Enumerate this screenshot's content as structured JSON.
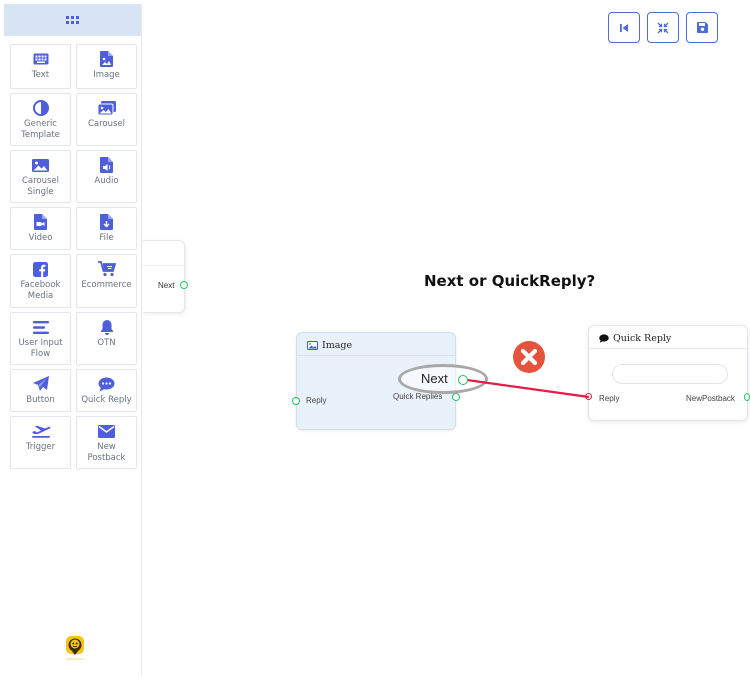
{
  "sidebar": {
    "header_icon": "grid-icon",
    "items": [
      {
        "label": "Text",
        "icon": "keyboard-icon"
      },
      {
        "label": "Image",
        "icon": "image-file-icon"
      },
      {
        "label": "Generic Template",
        "icon": "half-circle-icon"
      },
      {
        "label": "Carousel",
        "icon": "images-icon"
      },
      {
        "label": "Carousel Single",
        "icon": "picture-icon"
      },
      {
        "label": "Audio",
        "icon": "audio-file-icon"
      },
      {
        "label": "Video",
        "icon": "video-file-icon"
      },
      {
        "label": "File",
        "icon": "download-file-icon"
      },
      {
        "label": "Facebook Media",
        "icon": "facebook-icon"
      },
      {
        "label": "Ecommerce",
        "icon": "cart-icon"
      },
      {
        "label": "User Input Flow",
        "icon": "lines-icon"
      },
      {
        "label": "OTN",
        "icon": "bell-icon"
      },
      {
        "label": "Button",
        "icon": "send-icon"
      },
      {
        "label": "Quick Reply",
        "icon": "chat-bubble-icon"
      },
      {
        "label": "Trigger",
        "icon": "plane-icon"
      },
      {
        "label": "New Postback",
        "icon": "envelope-icon"
      }
    ],
    "bottom_icon": "bot-logo-icon"
  },
  "toolbar": {
    "buttons": [
      {
        "name": "skip-back-button",
        "icon": "skip-back-icon"
      },
      {
        "name": "fit-view-button",
        "icon": "compress-icon"
      },
      {
        "name": "save-button",
        "icon": "floppy-icon"
      }
    ]
  },
  "canvas": {
    "partial_node": {
      "next_label": "Next"
    },
    "question": "Next or QuickReply?",
    "image_node": {
      "title": "Image",
      "next_label": "Next",
      "quick_replies_label": "Quick Replies",
      "reply_label": "Reply"
    },
    "quick_reply_node": {
      "title": "Quick Reply",
      "input_value": "",
      "reply_label": "Reply",
      "new_postback_label": "NewPostback"
    }
  },
  "colors": {
    "accent": "#4e5fd9",
    "connection": "#e11d48",
    "error": "#e5533d",
    "node_image_bg": "#e9f1fb",
    "port_green": "#22c55e"
  }
}
